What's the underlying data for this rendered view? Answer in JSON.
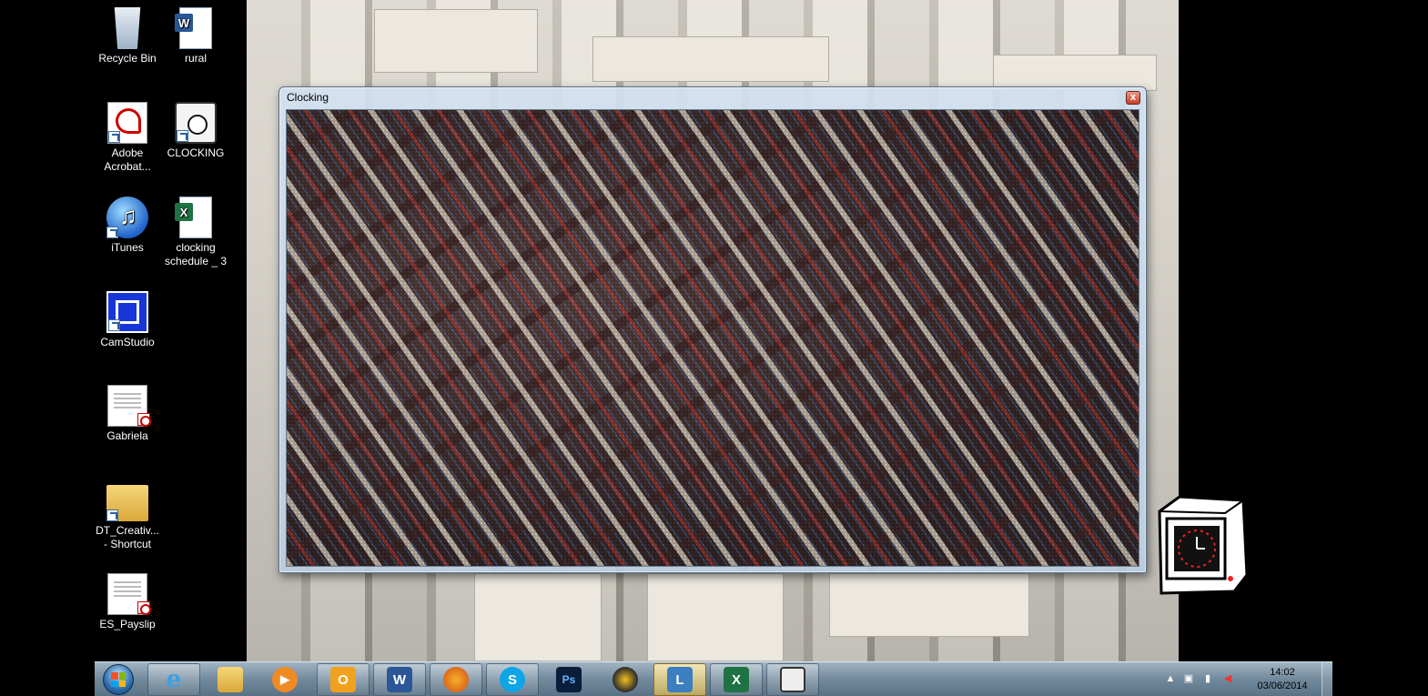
{
  "desktop": {
    "icons": [
      {
        "label": "Recycle Bin"
      },
      {
        "label": "rural"
      },
      {
        "label": "Adobe Acrobat..."
      },
      {
        "label": "CLOCKING"
      },
      {
        "label": "iTunes"
      },
      {
        "label": "clocking schedule _ 3"
      },
      {
        "label": "CamStudio"
      },
      {
        "label": "Gabriela"
      },
      {
        "label": "DT_Creativ... - Shortcut"
      },
      {
        "label": "ES_Payslip"
      }
    ]
  },
  "window": {
    "title": "Clocking",
    "close_glyph": "x"
  },
  "taskbar": {
    "pinned": [
      {
        "icon": "internet-explorer-icon"
      },
      {
        "icon": "file-explorer-icon"
      },
      {
        "icon": "media-player-icon"
      },
      {
        "icon": "outlook-icon"
      },
      {
        "icon": "word-icon"
      },
      {
        "icon": "firefox-icon"
      },
      {
        "icon": "skype-icon"
      },
      {
        "icon": "photoshop-icon"
      },
      {
        "icon": "audio-icon"
      },
      {
        "icon": "remote-desktop-icon"
      },
      {
        "icon": "excel-icon"
      },
      {
        "icon": "clocking-icon"
      }
    ],
    "clock": {
      "time": "14:02",
      "date": "03/06/2014"
    }
  },
  "colors": {
    "taskbar_top": "#aabecd",
    "window_frame": "#d2e1f0",
    "close_red": "#c8402a"
  }
}
